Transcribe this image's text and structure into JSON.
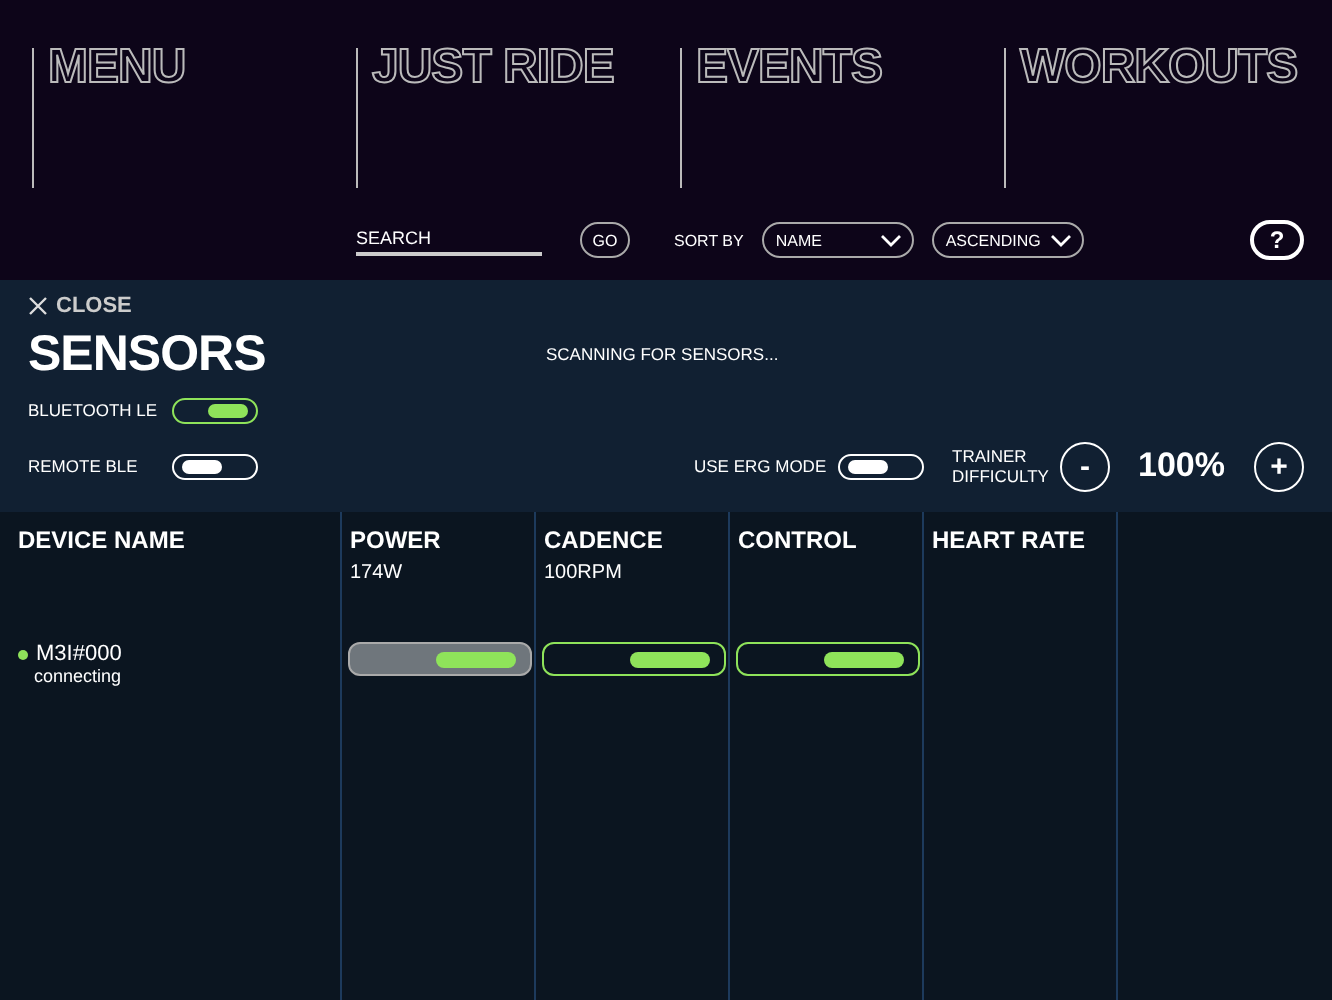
{
  "nav": [
    {
      "label": "MENU"
    },
    {
      "label": "JUST RIDE"
    },
    {
      "label": "EVENTS"
    },
    {
      "label": "WORKOUTS"
    }
  ],
  "toolbar": {
    "search": {
      "placeholder": "SEARCH"
    },
    "go": "GO",
    "sort_label": "SORT BY",
    "sort_field": "NAME",
    "sort_order": "ASCENDING",
    "help": "?"
  },
  "panel": {
    "close": "CLOSE",
    "title": "SENSORS",
    "status": "SCANNING FOR SENSORS...",
    "toggles": [
      {
        "label": "BLUETOOTH  LE",
        "on": true
      },
      {
        "label": "REMOTE BLE",
        "on": false
      }
    ],
    "erg": {
      "label": "USE ERG MODE",
      "on": false
    },
    "difficulty": {
      "label": "TRAINER DIFFICULTY",
      "minus": "-",
      "value": "100%",
      "plus": "+"
    }
  },
  "table": {
    "columns": [
      {
        "title": "DEVICE NAME"
      },
      {
        "title": "POWER",
        "reading": "174W"
      },
      {
        "title": "CADENCE",
        "reading": "100RPM"
      },
      {
        "title": "CONTROL"
      },
      {
        "title": "HEART RATE"
      }
    ],
    "rows": [
      {
        "name": "M3I#000",
        "status": "connecting",
        "color": "#8fe35a",
        "cells": [
          {
            "on": true,
            "selected": true
          },
          {
            "on": true,
            "selected": false
          },
          {
            "on": true,
            "selected": false
          }
        ]
      }
    ]
  }
}
